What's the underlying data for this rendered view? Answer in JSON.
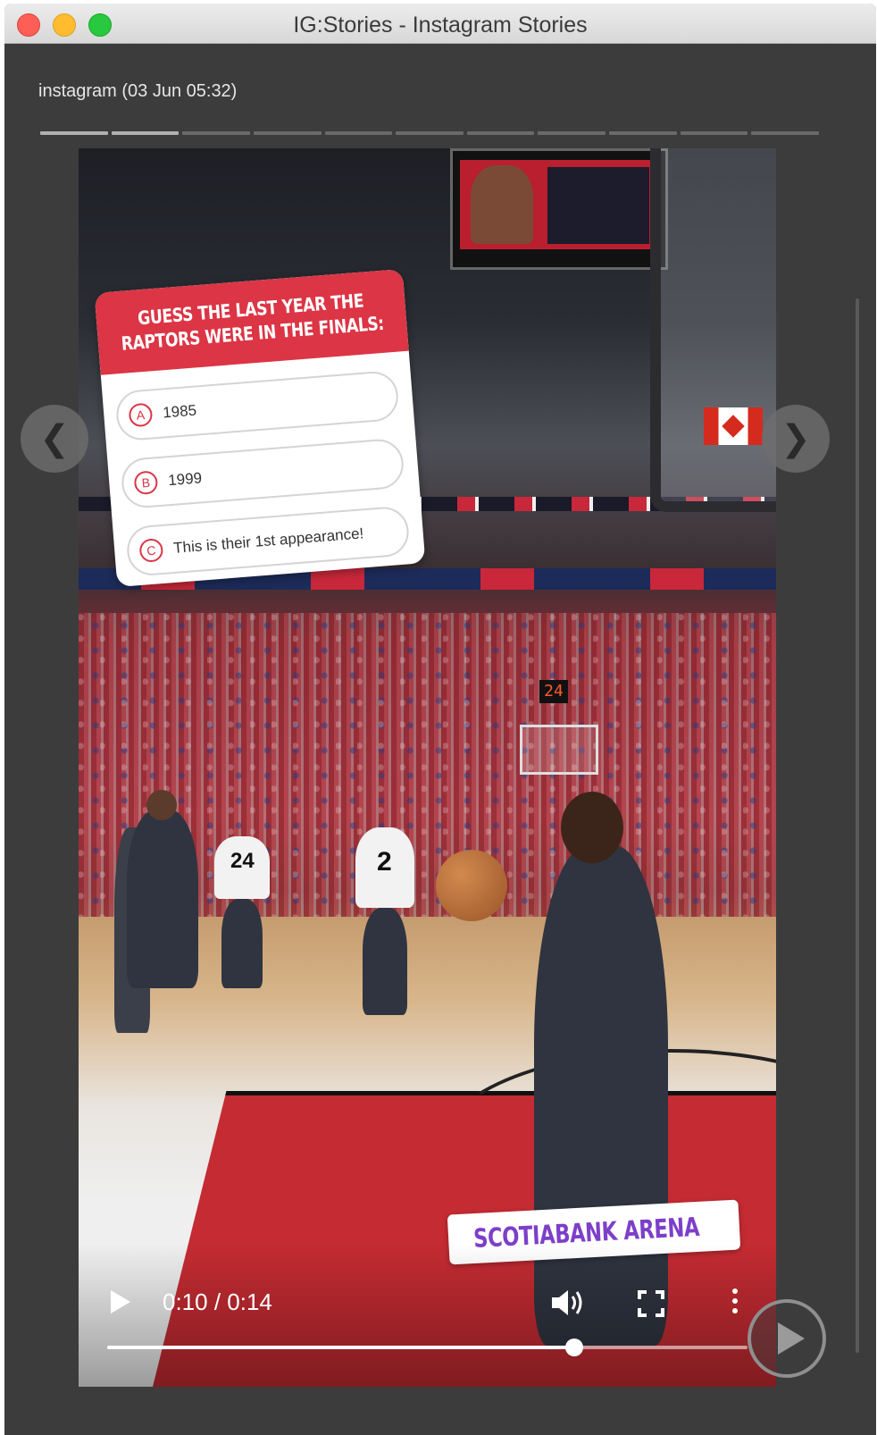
{
  "window": {
    "title": "IG:Stories - Instagram Stories"
  },
  "story": {
    "header": "instagram (03 Jun 05:32)",
    "segments_total": 11,
    "segments_completed": 2
  },
  "poll": {
    "question": "GUESS THE LAST YEAR THE RAPTORS WERE IN THE FINALS:",
    "options": [
      {
        "letter": "A",
        "text": "1985"
      },
      {
        "letter": "B",
        "text": "1999"
      },
      {
        "letter": "C",
        "text": "This is their 1st appearance!"
      }
    ]
  },
  "location": {
    "name": "SCOTIABANK ARENA",
    "icon": "location-pin-icon"
  },
  "scene": {
    "shot_clock": "24",
    "jersey_numbers": [
      "24",
      "2"
    ]
  },
  "player": {
    "time": "0:10 / 0:14",
    "progress_fraction": 0.73,
    "play_icon": "play-icon",
    "volume_icon": "volume-icon",
    "fullscreen_icon": "fullscreen-icon",
    "more_icon": "more-vertical-icon"
  },
  "navigation": {
    "prev": "❮",
    "next": "❯",
    "autoplay_icon": "play-circle-icon"
  },
  "colors": {
    "poll_accent": "#dc3545",
    "location_text": "#7d3fc9",
    "window_bg": "#3c3c3c"
  }
}
